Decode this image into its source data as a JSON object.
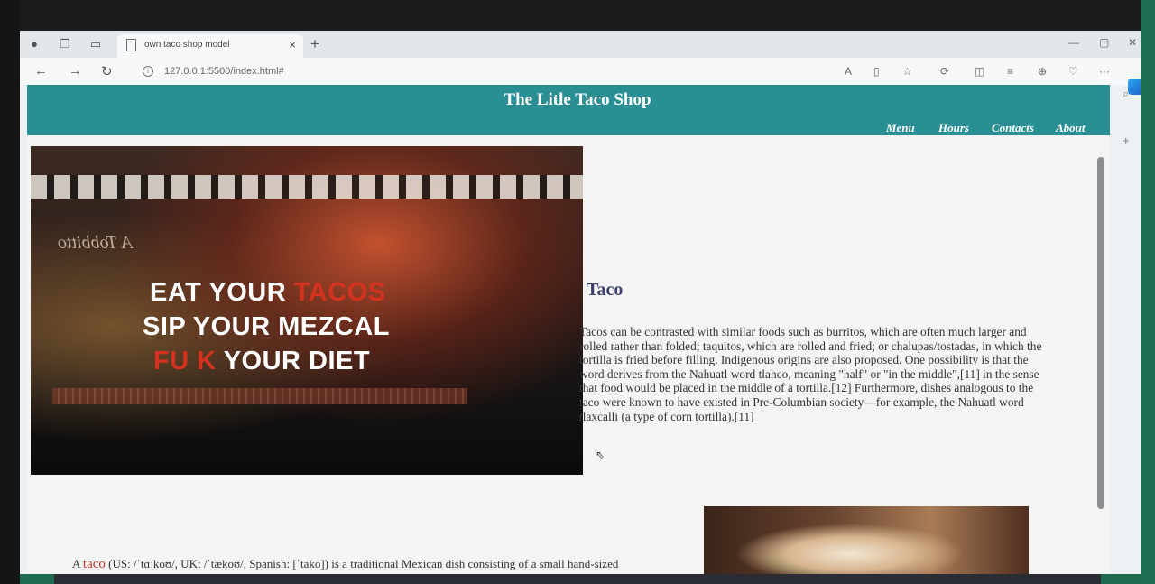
{
  "browser": {
    "tab_title": "own taco shop model",
    "tab_close": "×",
    "new_tab": "+",
    "url": "127.0.0.1:5500/index.html#",
    "read_aloud": "A",
    "more": "···",
    "window_controls": {
      "minimize": "—",
      "maximize": "▢",
      "close": "✕"
    },
    "sidebar_search": "⌕",
    "sidebar_add": "+"
  },
  "header": {
    "title": "The Litle Taco Shop",
    "menu": [
      "Menu",
      "Hours",
      "Contacts",
      "About"
    ]
  },
  "hero": {
    "line1_a": "EAT YOUR ",
    "line1_b": "TACOS",
    "line2": "SIP YOUR MEZCAL",
    "line3_a": "FU  K ",
    "line3_b": "YOUR DIET",
    "sign_text": "A Tobbitto"
  },
  "article": {
    "heading": "Taco",
    "body": "Tacos can be contrasted with similar foods such as burritos, which are often much larger and rolled rather than folded; taquitos, which are rolled and fried; or chalupas/tostadas, in which the tortilla is fried before filling. Indigenous origins are also proposed. One possibility is that the word derives from the Nahuatl word tlahco, meaning \"half\" or \"in the middle\",[11] in the sense that food would be placed in the middle of a tortilla.[12] Furthermore, dishes analogous to the taco were known to have existed in Pre-Columbian society—for example, the Nahuatl word tlaxcalli (a type of corn tortilla).[11]"
  },
  "intro": {
    "a": "A ",
    "word": "taco",
    "rest": " (US: /ˈtɑːkoʊ/, UK: /ˈtækoʊ/, Spanish: [ˈtako]) is a traditional Mexican dish consisting of a small hand-sized"
  },
  "colors": {
    "header": "#2a8f95",
    "accent": "#c03a2b"
  }
}
